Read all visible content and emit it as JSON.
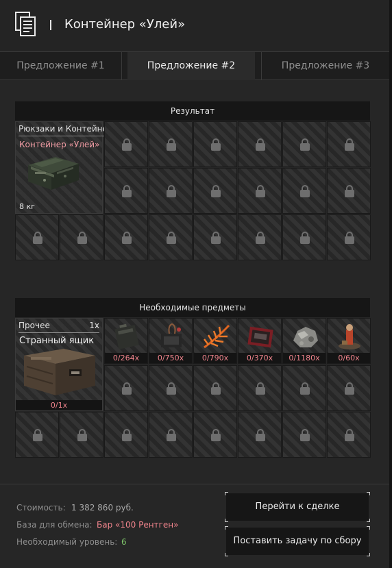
{
  "header": {
    "title": "Контейнер «Улей»",
    "icon": "document-icon"
  },
  "tabs": [
    {
      "label": "Предложение #1",
      "active": false
    },
    {
      "label": "Предложение #2",
      "active": true
    },
    {
      "label": "Предложение #3",
      "active": false
    }
  ],
  "result": {
    "header": "Результат",
    "category": "Рюкзаки и Контейнеры",
    "item_name": "Контейнер «Улей»",
    "weight": "8 кг",
    "item_icon": "container-crate-icon",
    "locked_slots": 18
  },
  "required": {
    "header": "Необходимые предметы",
    "main_item": {
      "category": "Прочее",
      "count": "1x",
      "name": "Странный ящик",
      "quantity": "0/1x",
      "icon": "wooden-box-icon"
    },
    "items": [
      {
        "quantity": "0/264x",
        "icon": "ammo-crate-icon"
      },
      {
        "quantity": "0/750x",
        "icon": "device-icon"
      },
      {
        "quantity": "0/790x",
        "icon": "fern-plant-icon"
      },
      {
        "quantity": "0/370x",
        "icon": "red-case-icon"
      },
      {
        "quantity": "0/1180x",
        "icon": "ore-chunk-icon"
      },
      {
        "quantity": "0/60x",
        "icon": "figure-icon"
      }
    ],
    "locked_slots": 14
  },
  "info": {
    "cost_label": "Стоимость:",
    "cost_value": "1 382 860 руб.",
    "base_label": "База для обмена:",
    "base_value": "Бар «100 Рентген»",
    "level_label": "Необходимый уровень:",
    "level_value": "6"
  },
  "buttons": {
    "go_to_deal": "Перейти к сделке",
    "set_task": "Поставить задачу по сбору"
  },
  "colors": {
    "accent_pink": "#f0848c",
    "level_green": "#7ec46a",
    "background": "#262626"
  }
}
